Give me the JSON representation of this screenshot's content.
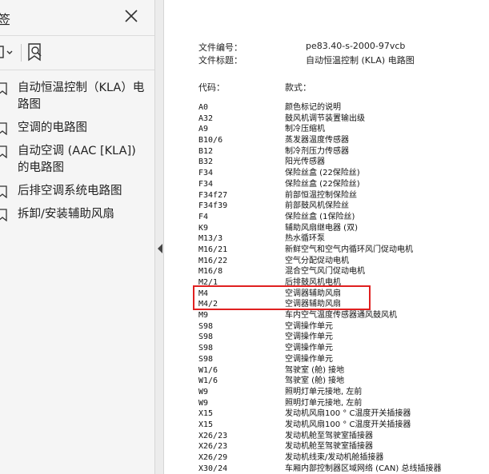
{
  "sidebar": {
    "title": "签",
    "items": [
      {
        "label": "自动恒温控制（KLA）电路图"
      },
      {
        "label": "空调的电路图"
      },
      {
        "label": "自动空调 (AAC [KLA]) 的电路图"
      },
      {
        "label": "后排空调系统电路图"
      },
      {
        "label": "拆卸/安装辅助风扇"
      }
    ]
  },
  "document": {
    "file_no_label": "文件编号：",
    "file_no_value": "pe83.40-s-2000-97vcb",
    "file_title_label": "文件标题：",
    "file_title_value": "自动恒温控制 (KLA) 电路图",
    "col_code": "代码：",
    "col_desc": "款式：",
    "rows": [
      {
        "code": "A0",
        "desc": "颜色标记的说明"
      },
      {
        "code": "A32",
        "desc": "鼓风机调节装置输出级"
      },
      {
        "code": "A9",
        "desc": "制冷压缩机"
      },
      {
        "code": "B10/6",
        "desc": "蒸发器温度传感器"
      },
      {
        "code": "B12",
        "desc": "制冷剂压力传感器"
      },
      {
        "code": "B32",
        "desc": "阳光传感器"
      },
      {
        "code": "F34",
        "desc": "保险丝盒 (22保险丝)"
      },
      {
        "code": "F34",
        "desc": "保险丝盒 (22保险丝)"
      },
      {
        "code": "F34f27",
        "desc": "前部恒温控制保险丝"
      },
      {
        "code": "F34f39",
        "desc": "前部鼓风机保险丝"
      },
      {
        "code": "F4",
        "desc": "保险丝盒 (1保险丝)"
      },
      {
        "code": "K9",
        "desc": "辅助风扇继电器 (双)"
      },
      {
        "code": "M13/3",
        "desc": "热水循环泵"
      },
      {
        "code": "M16/21",
        "desc": "新鲜空气和空气内循环风门促动电机"
      },
      {
        "code": "M16/22",
        "desc": "空气分配促动电机"
      },
      {
        "code": "M16/8",
        "desc": "混合空气风门促动电机"
      },
      {
        "code": "M2/1",
        "desc": "后排鼓风机电机"
      },
      {
        "code": "M4",
        "desc": "空调器辅助风扇"
      },
      {
        "code": "M4/2",
        "desc": "空调器辅助风扇"
      },
      {
        "code": "M9",
        "desc": "车内空气温度传感器通风鼓风机"
      },
      {
        "code": "S98",
        "desc": "空调操作单元"
      },
      {
        "code": "S98",
        "desc": "空调操作单元"
      },
      {
        "code": "S98",
        "desc": "空调操作单元"
      },
      {
        "code": "S98",
        "desc": "空调操作单元"
      },
      {
        "code": "W1/6",
        "desc": "驾驶室 (舱) 接地"
      },
      {
        "code": "W1/6",
        "desc": "驾驶室 (舱) 接地"
      },
      {
        "code": "W9",
        "desc": "照明灯单元接地, 左前"
      },
      {
        "code": "W9",
        "desc": "照明灯单元接地, 左前"
      },
      {
        "code": "X15",
        "desc": "发动机风扇100 ° C温度开关插接器"
      },
      {
        "code": "X15",
        "desc": "发动机风扇100 ° C温度开关插接器"
      },
      {
        "code": "X26/23",
        "desc": "发动机舱至驾驶室插接器"
      },
      {
        "code": "X26/23",
        "desc": "发动机舱至驾驶室插接器"
      },
      {
        "code": "X26/29",
        "desc": "发动机线束/发动机舱插接器"
      },
      {
        "code": "X30/24",
        "desc": "车厢内部控制器区域网络 (CAN) 总线插接器"
      }
    ]
  },
  "colors": {
    "highlight": "#e02020",
    "sidebar_bg": "#f5f5f5"
  },
  "icons": {
    "close": "close-icon",
    "bookmark": "bookmark-icon",
    "add_bookmark": "bookmark-search-icon",
    "collapse": "collapse-left-icon"
  }
}
